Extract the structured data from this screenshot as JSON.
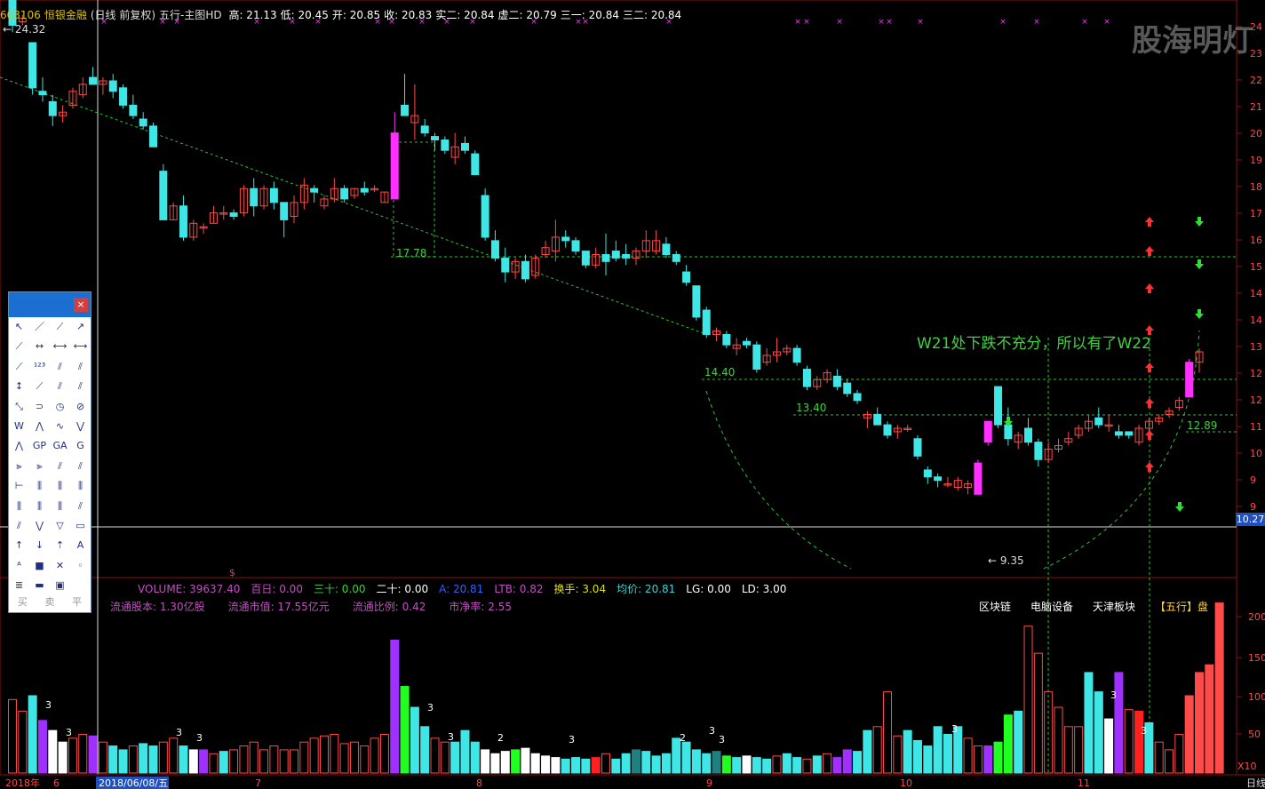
{
  "header": {
    "code": "603106",
    "name": "恒银金融",
    "mode": "(日线 前复权)",
    "template": "五行-主图HD",
    "fields": [
      {
        "label": "高:",
        "value": "21.13",
        "color": "#ffffff"
      },
      {
        "label": "低:",
        "value": "20.45",
        "color": "#ffffff"
      },
      {
        "label": "开:",
        "value": "20.85",
        "color": "#ffffff"
      },
      {
        "label": "收:",
        "value": "20.83",
        "color": "#ffffff"
      },
      {
        "label": "实二:",
        "value": "20.84",
        "color": "#ffffff"
      },
      {
        "label": "虚二:",
        "value": "20.79",
        "color": "#ffffff"
      },
      {
        "label": "三一:",
        "value": "20.84",
        "color": "#ffffff"
      },
      {
        "label": "三二:",
        "value": "20.84",
        "color": "#ffffff"
      }
    ]
  },
  "watermark": "股海明灯",
  "annotation": "W21处下跌不充分，所以有了W22",
  "price_labels": {
    "top_left": "24.32",
    "l1": "17.78",
    "l2": "14.40",
    "l3": "13.40",
    "l4": "12.89",
    "low": "9.35",
    "current": "10.27"
  },
  "right_axis": [
    "24",
    "23",
    "22",
    "21",
    "20",
    "19",
    "18",
    "17",
    "16",
    "15",
    "14",
    "14",
    "13",
    "12",
    "12",
    "11",
    "10",
    "9",
    "9"
  ],
  "volume_axis": [
    "200",
    "150",
    "100",
    "50",
    "X10"
  ],
  "indicator_line": [
    {
      "label": "VOLUME: 39637.40",
      "color": "#c050c0"
    },
    {
      "label": "百日: 0.00",
      "color": "#c050c0"
    },
    {
      "label": "三十: 0.00",
      "color": "#40d040"
    },
    {
      "label": "二十: 0.00",
      "color": "#ffffff"
    },
    {
      "label": "A: 20.81",
      "color": "#3060ff"
    },
    {
      "label": "LTB: 0.82",
      "color": "#c050c0"
    },
    {
      "label": "换手: 3.04",
      "color": "#e0e000"
    },
    {
      "label": "均价: 20.81",
      "color": "#40d0d0"
    },
    {
      "label": "LG: 0.00",
      "color": "#ffffff"
    },
    {
      "label": "LD: 3.00",
      "color": "#ffffff"
    }
  ],
  "stats": [
    {
      "label": "流通股本:",
      "value": "1.30亿股"
    },
    {
      "label": "流通市值:",
      "value": "17.55亿元"
    },
    {
      "label": "流通比例:",
      "value": "0.42"
    },
    {
      "label": "市净率:",
      "value": "2.55"
    }
  ],
  "tags": [
    "区块链",
    "电脑设备",
    "天津板块",
    "【五行】盘"
  ],
  "toolbox": {
    "footer": [
      "买",
      "卖",
      "平"
    ]
  },
  "date_axis": {
    "labels": [
      "2018年",
      "6",
      "2018/06/08/五",
      "7",
      "8",
      "9",
      "10",
      "11"
    ],
    "right_label": "日线"
  },
  "colors": {
    "up": "#ff4a4a",
    "down": "#3fe6e6",
    "magenta": "#ff30ff",
    "purple": "#a030ff",
    "green": "#20ff20"
  },
  "chart_data": {
    "type": "candlestick",
    "candles": [
      [
        23.5,
        24.3,
        22.3,
        22.5
      ],
      [
        22.6,
        22.8,
        22.5,
        22.7
      ],
      [
        22.0,
        22.0,
        20.5,
        20.7
      ],
      [
        20.6,
        21.0,
        20.3,
        20.5
      ],
      [
        20.3,
        20.5,
        19.6,
        19.9
      ],
      [
        19.9,
        20.2,
        19.7,
        20.0
      ],
      [
        20.2,
        20.7,
        20.1,
        20.6
      ],
      [
        20.5,
        21.0,
        20.4,
        20.8
      ],
      [
        21.0,
        21.3,
        20.8,
        20.8
      ],
      [
        20.8,
        21.0,
        20.5,
        20.9
      ],
      [
        20.9,
        21.1,
        20.4,
        20.6
      ],
      [
        20.7,
        20.8,
        20.1,
        20.2
      ],
      [
        20.2,
        20.5,
        19.8,
        19.9
      ],
      [
        19.8,
        20.0,
        19.5,
        19.6
      ],
      [
        19.6,
        19.7,
        19.0,
        19.0
      ],
      [
        18.3,
        18.5,
        16.9,
        16.9
      ],
      [
        16.9,
        17.4,
        16.9,
        17.3
      ],
      [
        17.3,
        17.6,
        16.3,
        16.4
      ],
      [
        16.4,
        16.9,
        16.3,
        16.8
      ],
      [
        16.7,
        16.8,
        16.5,
        16.7
      ],
      [
        16.8,
        17.3,
        16.8,
        17.1
      ],
      [
        17.1,
        17.3,
        16.9,
        17.1
      ],
      [
        17.1,
        17.2,
        16.9,
        17.0
      ],
      [
        17.1,
        17.9,
        17.0,
        17.8
      ],
      [
        17.8,
        18.1,
        17.0,
        17.3
      ],
      [
        17.3,
        17.9,
        17.2,
        17.8
      ],
      [
        17.8,
        18.0,
        17.2,
        17.4
      ],
      [
        17.4,
        17.4,
        16.4,
        16.9
      ],
      [
        17.0,
        17.6,
        16.8,
        17.4
      ],
      [
        17.4,
        18.1,
        17.2,
        17.9
      ],
      [
        17.8,
        17.9,
        17.4,
        17.7
      ],
      [
        17.3,
        17.6,
        17.2,
        17.5
      ],
      [
        17.5,
        18.1,
        17.4,
        17.8
      ],
      [
        17.8,
        17.9,
        17.4,
        17.5
      ],
      [
        17.6,
        17.8,
        17.5,
        17.8
      ],
      [
        17.8,
        18.0,
        17.6,
        17.7
      ],
      [
        17.8,
        17.9,
        17.7,
        17.8
      ],
      [
        17.4,
        17.7,
        17.4,
        17.7
      ],
      [
        17.5,
        20.0,
        17.5,
        19.4
      ],
      [
        20.2,
        21.1,
        20.0,
        19.9
      ],
      [
        19.7,
        20.8,
        19.2,
        19.9
      ],
      [
        19.6,
        19.8,
        19.3,
        19.4
      ],
      [
        19.3,
        19.4,
        18.9,
        19.2
      ],
      [
        19.2,
        19.3,
        18.8,
        18.9
      ],
      [
        18.7,
        19.4,
        18.5,
        19.0
      ],
      [
        19.1,
        19.3,
        18.8,
        18.9
      ],
      [
        18.8,
        18.9,
        18.2,
        18.2
      ],
      [
        17.6,
        17.8,
        16.3,
        16.4
      ],
      [
        16.3,
        16.6,
        15.7,
        15.8
      ],
      [
        15.8,
        16.1,
        15.1,
        15.4
      ],
      [
        15.4,
        15.8,
        15.2,
        15.7
      ],
      [
        15.7,
        15.9,
        15.1,
        15.2
      ],
      [
        15.3,
        15.9,
        15.2,
        15.8
      ],
      [
        15.9,
        16.3,
        15.8,
        16.1
      ],
      [
        16.0,
        16.9,
        15.7,
        16.4
      ],
      [
        16.4,
        16.6,
        16.1,
        16.3
      ],
      [
        16.3,
        16.4,
        15.9,
        16.0
      ],
      [
        16.0,
        16.0,
        15.5,
        15.6
      ],
      [
        15.6,
        16.1,
        15.5,
        15.9
      ],
      [
        15.9,
        16.5,
        15.3,
        15.7
      ],
      [
        16.0,
        16.3,
        15.7,
        15.8
      ],
      [
        15.9,
        16.2,
        15.6,
        15.8
      ],
      [
        15.8,
        16.1,
        15.6,
        16.0
      ],
      [
        16.0,
        16.6,
        15.8,
        16.3
      ],
      [
        16.0,
        16.6,
        15.9,
        16.3
      ],
      [
        16.2,
        16.4,
        15.8,
        15.9
      ],
      [
        15.9,
        16.0,
        15.6,
        15.7
      ],
      [
        15.4,
        15.6,
        15.0,
        15.1
      ],
      [
        15.0,
        15.0,
        14.0,
        14.1
      ],
      [
        14.3,
        14.4,
        13.5,
        13.6
      ],
      [
        13.6,
        13.8,
        13.4,
        13.7
      ],
      [
        13.6,
        13.7,
        13.2,
        13.3
      ],
      [
        13.2,
        13.5,
        13.0,
        13.3
      ],
      [
        13.4,
        13.5,
        13.2,
        13.3
      ],
      [
        13.3,
        13.4,
        12.5,
        12.6
      ],
      [
        12.8,
        13.2,
        12.7,
        13.0
      ],
      [
        13.0,
        13.5,
        12.8,
        13.1
      ],
      [
        13.1,
        13.3,
        13.0,
        13.2
      ],
      [
        13.2,
        13.3,
        12.7,
        12.8
      ],
      [
        12.6,
        12.7,
        12.0,
        12.1
      ],
      [
        12.1,
        12.4,
        12.0,
        12.3
      ],
      [
        12.3,
        12.6,
        12.2,
        12.5
      ],
      [
        12.4,
        12.6,
        12.0,
        12.1
      ],
      [
        12.2,
        12.3,
        11.8,
        11.9
      ],
      [
        11.9,
        12.0,
        11.6,
        11.7
      ],
      [
        11.2,
        11.4,
        10.9,
        11.3
      ],
      [
        11.3,
        11.5,
        11.0,
        11.0
      ],
      [
        11.0,
        11.1,
        10.6,
        10.7
      ],
      [
        10.8,
        11.0,
        10.6,
        10.9
      ],
      [
        10.9,
        11.0,
        10.8,
        10.9
      ],
      [
        10.6,
        10.7,
        10.0,
        10.1
      ],
      [
        9.7,
        9.8,
        9.3,
        9.5
      ],
      [
        9.5,
        9.6,
        9.2,
        9.4
      ],
      [
        9.3,
        9.5,
        9.2,
        9.3
      ],
      [
        9.2,
        9.5,
        9.1,
        9.4
      ],
      [
        9.2,
        9.4,
        9.0,
        9.3
      ],
      [
        9.0,
        10.0,
        9.0,
        9.9
      ],
      [
        10.5,
        11.1,
        10.4,
        11.1
      ],
      [
        12.1,
        12.1,
        10.9,
        11.0
      ],
      [
        11.0,
        11.5,
        10.4,
        10.6
      ],
      [
        10.5,
        10.8,
        10.3,
        10.7
      ],
      [
        10.9,
        11.2,
        10.4,
        10.5
      ],
      [
        10.5,
        10.6,
        9.8,
        10.0
      ],
      [
        10.0,
        10.5,
        9.9,
        10.3
      ],
      [
        10.3,
        10.6,
        10.2,
        10.4
      ],
      [
        10.5,
        10.8,
        10.4,
        10.6
      ],
      [
        10.7,
        11.0,
        10.6,
        10.9
      ],
      [
        10.9,
        11.3,
        10.8,
        11.1
      ],
      [
        11.2,
        11.5,
        10.9,
        11.0
      ],
      [
        11.0,
        11.3,
        10.8,
        11.0
      ],
      [
        10.8,
        11.0,
        10.6,
        10.7
      ],
      [
        10.8,
        10.8,
        10.6,
        10.7
      ],
      [
        10.5,
        11.0,
        10.4,
        10.9
      ],
      [
        10.9,
        11.2,
        10.8,
        11.1
      ],
      [
        11.1,
        11.3,
        11.0,
        11.2
      ],
      [
        11.3,
        11.5,
        11.2,
        11.4
      ],
      [
        11.5,
        11.8,
        11.4,
        11.7
      ],
      [
        11.8,
        12.9,
        11.8,
        12.8
      ],
      [
        12.8,
        13.2,
        12.5,
        13.1
      ]
    ],
    "volumes": [
      95,
      80,
      100,
      68,
      55,
      40,
      45,
      50,
      48,
      40,
      35,
      30,
      35,
      38,
      35,
      40,
      45,
      35,
      30,
      30,
      25,
      28,
      30,
      35,
      40,
      30,
      35,
      30,
      30,
      40,
      45,
      48,
      50,
      38,
      40,
      35,
      45,
      50,
      172,
      112,
      85,
      60,
      45,
      40,
      40,
      55,
      40,
      30,
      25,
      28,
      30,
      32,
      25,
      22,
      20,
      18,
      20,
      18,
      20,
      25,
      18,
      25,
      30,
      28,
      22,
      25,
      45,
      40,
      30,
      25,
      28,
      22,
      20,
      22,
      20,
      18,
      22,
      25,
      20,
      18,
      22,
      25,
      20,
      30,
      28,
      55,
      60,
      105,
      48,
      55,
      42,
      35,
      60,
      50,
      60,
      45,
      35,
      35,
      40,
      75,
      80,
      190,
      155,
      105,
      85,
      60,
      60,
      130,
      105,
      70,
      130,
      82,
      80,
      65,
      40,
      30,
      50,
      100,
      130,
      140,
      220
    ],
    "volume_colors": [
      "u",
      "u",
      "d",
      "p",
      "w",
      "w",
      "u",
      "u",
      "p",
      "u",
      "d",
      "d",
      "u",
      "d",
      "d",
      "u",
      "u",
      "d",
      "w",
      "p",
      "u",
      "d",
      "u",
      "u",
      "u",
      "u",
      "u",
      "u",
      "u",
      "u",
      "u",
      "u",
      "u",
      "u",
      "u",
      "u",
      "u",
      "u",
      "p",
      "g",
      "d",
      "d",
      "u",
      "u",
      "d",
      "d",
      "d",
      "w",
      "w",
      "w",
      "g",
      "w",
      "w",
      "w",
      "w",
      "d",
      "d",
      "d",
      "r",
      "u",
      "d",
      "d",
      "t",
      "d",
      "d",
      "d",
      "d",
      "d",
      "d",
      "d",
      "t",
      "g",
      "d",
      "w",
      "d",
      "d",
      "u",
      "d",
      "d",
      "u",
      "d",
      "u",
      "p",
      "p",
      "d",
      "d",
      "u",
      "u",
      "u",
      "d",
      "d",
      "d",
      "d",
      "d",
      "d",
      "u",
      "u",
      "p",
      "g",
      "g",
      "d",
      "u",
      "u",
      "u",
      "u",
      "u",
      "u",
      "d",
      "d",
      "w",
      "p",
      "u",
      "r",
      "d",
      "u",
      "u",
      "u"
    ]
  }
}
